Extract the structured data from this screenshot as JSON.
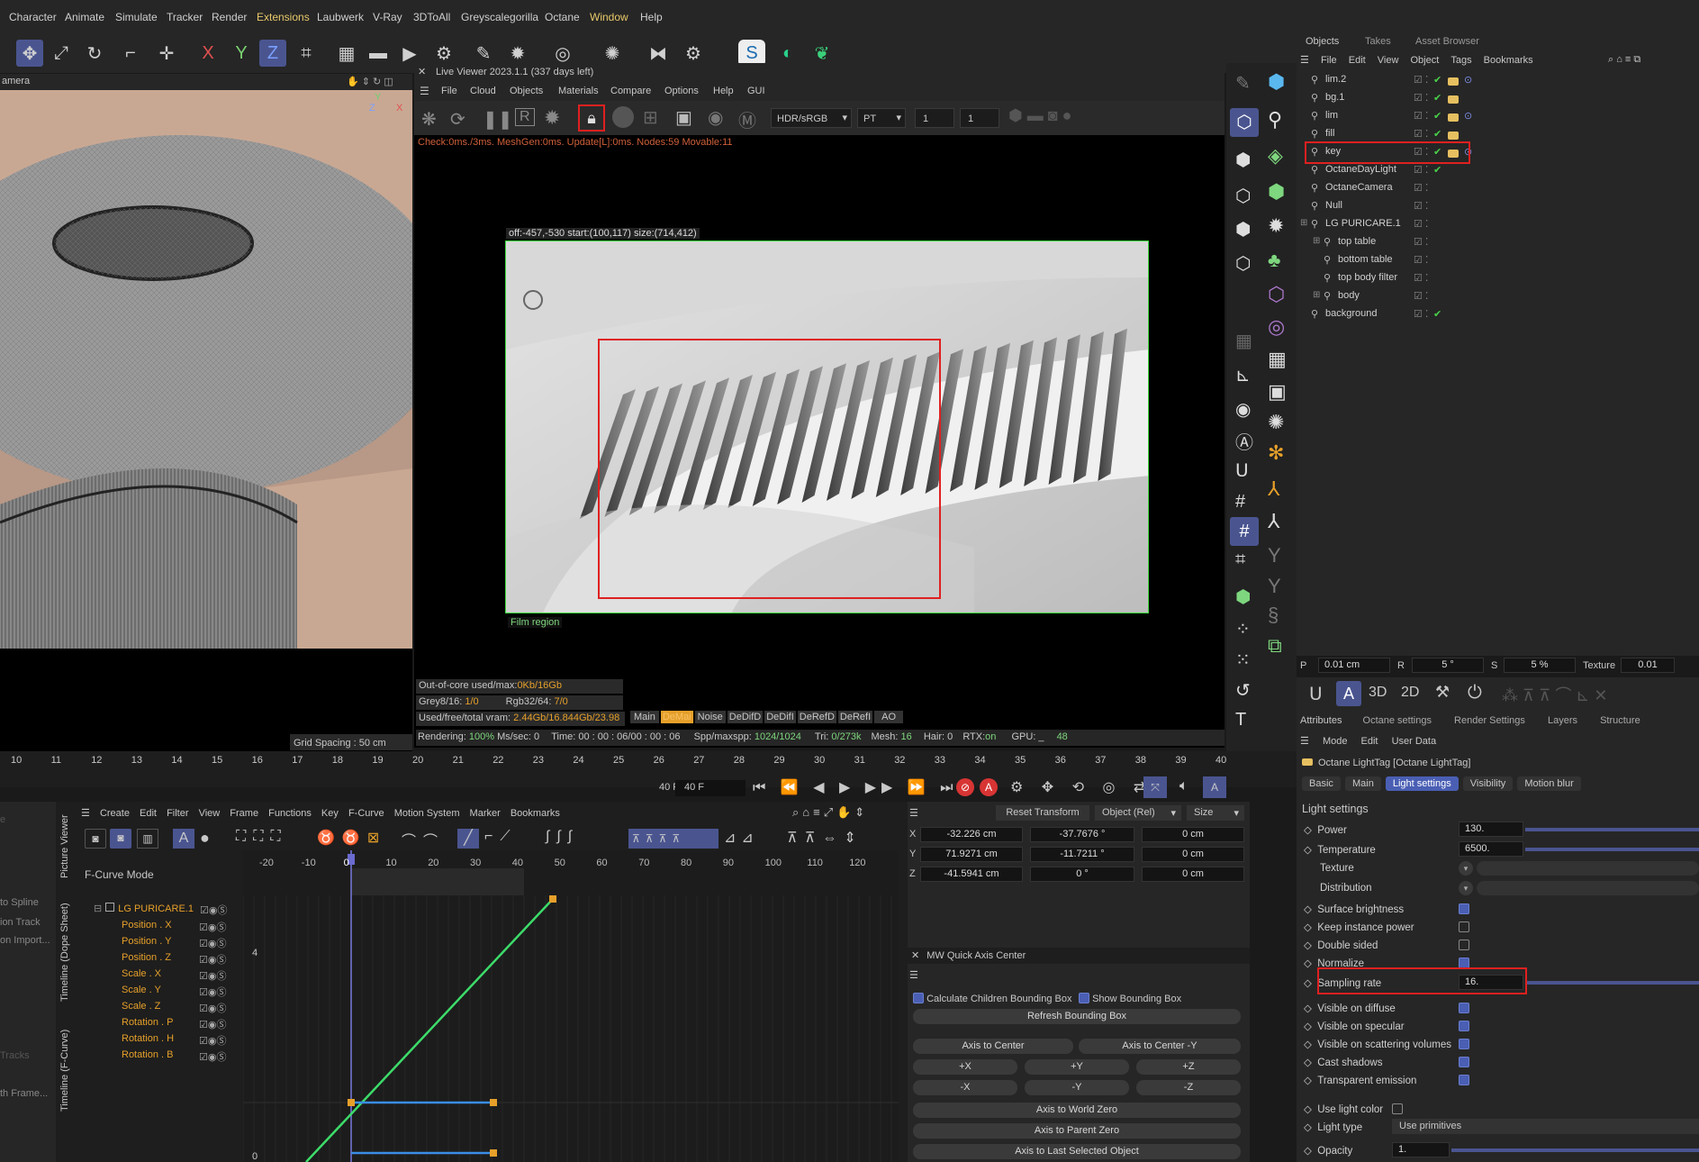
{
  "menubar": {
    "items": [
      "Character",
      "Animate",
      "Simulate",
      "Tracker",
      "Render",
      "Extensions",
      "Laubwerk",
      "V-Ray",
      "3DToAll",
      "Greyscalegorilla",
      "Octane",
      "Window",
      "Help"
    ]
  },
  "viewport": {
    "camera_label": "amera",
    "grid_spacing": "Grid Spacing : 50 cm",
    "axis_y": "Y",
    "axis_z": "Z",
    "axis_x": "X"
  },
  "live_viewer": {
    "title": "Live Viewer 2023.1.1 (337 days left)",
    "menu": [
      "File",
      "Cloud",
      "Objects",
      "Materials",
      "Compare",
      "Options",
      "Help",
      "GUI"
    ],
    "color_space": "HDR/sRGB",
    "kernel": "PT",
    "field1": "1",
    "field2": "1",
    "check_line": "Check:0ms./3ms. MeshGen:0ms. Update[L]:0ms. Nodes:59 Movable:11",
    "region_info": "off:-457,-530 start:(100,117) size:(714,412)",
    "film_region": "Film region",
    "out_of_core": "Out-of-core used/max:",
    "out_of_core_val": "0Kb/16Gb",
    "grey": "Grey8/16: ",
    "grey_val": "1/0",
    "rgb": "Rgb32/64: ",
    "rgb_val": "7/0",
    "vram": "Used/free/total vram: ",
    "vram_val": "2.44Gb/16.844Gb/23.98",
    "tabs": [
      "Main",
      "DeMai",
      "Noise",
      "DeDifD",
      "DeDifI",
      "DeRefD",
      "DeRefI",
      "AO"
    ],
    "rendering": "Rendering: ",
    "rendering_val": "100%",
    "mss": " Ms/sec: 0",
    "time": "Time: 00 : 00 : 06/00 : 00 : 06",
    "spp": "Spp/maxspp: ",
    "spp_val": "1024/1024",
    "tri": "Tri: ",
    "tri_val": "0/273k",
    "mesh": "Mesh: ",
    "mesh_val": "16",
    "hair": "Hair: 0",
    "rtx": "RTX:",
    "rtx_val": "on",
    "gpu": "GPU: _",
    "gpu_val": "48"
  },
  "objects_panel": {
    "tabs": [
      "Objects",
      "Takes",
      "Asset Browser"
    ],
    "menu": [
      "File",
      "Edit",
      "View",
      "Object",
      "Tags",
      "Bookmarks"
    ],
    "rows": [
      {
        "name": "lim.2",
        "indent": 0
      },
      {
        "name": "bg.1",
        "indent": 0
      },
      {
        "name": "lim",
        "indent": 0
      },
      {
        "name": "fill",
        "indent": 0
      },
      {
        "name": "key",
        "indent": 0
      },
      {
        "name": "OctaneDayLight",
        "indent": 0
      },
      {
        "name": "OctaneCamera",
        "indent": 0
      },
      {
        "name": "Null",
        "indent": 0
      },
      {
        "name": "LG PURICARE.1",
        "indent": 0
      },
      {
        "name": "top table",
        "indent": 1
      },
      {
        "name": "bottom table",
        "indent": 1
      },
      {
        "name": "top body filter",
        "indent": 1
      },
      {
        "name": "body",
        "indent": 1
      },
      {
        "name": "background",
        "indent": 0
      }
    ],
    "coord_row": {
      "p_label": "P",
      "p_val": "0.01 cm",
      "r_label": "R",
      "r_val": "5 °",
      "s_label": "S",
      "s_val": "5 %",
      "tex_label": "Texture",
      "tex_val": "0.01"
    }
  },
  "attributes": {
    "tabs": [
      "Attributes",
      "Octane settings",
      "Render Settings",
      "Layers",
      "Structure"
    ],
    "menu": [
      "Mode",
      "Edit",
      "User Data"
    ],
    "tag_title": "Octane LightTag [Octane LightTag]",
    "subtabs": [
      "Basic",
      "Main",
      "Light settings",
      "Visibility",
      "Motion blur"
    ],
    "section": "Light settings",
    "power_label": "Power",
    "power_val": "130.",
    "temp_label": "Temperature",
    "temp_val": "6500.",
    "texture_label": "Texture",
    "distribution_label": "Distribution",
    "surface_brightness": "Surface brightness",
    "keep_instance": "Keep instance power",
    "double_sided": "Double sided",
    "normalize": "Normalize",
    "sampling_label": "Sampling rate",
    "sampling_val": "16.",
    "vis_diffuse": "Visible on diffuse",
    "vis_specular": "Visible on specular",
    "vis_scatter": "Visible on scattering volumes",
    "cast_shadows": "Cast shadows",
    "transparent_emission": "Transparent emission",
    "use_light_color": "Use light color",
    "light_type_label": "Light type",
    "light_type_val": "Use primitives",
    "opacity_label": "Opacity",
    "opacity_val": "1."
  },
  "timeline": {
    "ticks": [
      "10",
      "11",
      "12",
      "13",
      "14",
      "15",
      "16",
      "17",
      "18",
      "19",
      "20",
      "21",
      "22",
      "23",
      "24",
      "25",
      "26",
      "27",
      "28",
      "29",
      "30",
      "31",
      "32",
      "33",
      "34",
      "35",
      "36",
      "37",
      "38",
      "39",
      "40"
    ],
    "frame_a": "40 F",
    "frame_b": "40 F"
  },
  "fcurve": {
    "menu": [
      "Create",
      "Edit",
      "Filter",
      "View",
      "Frame",
      "Functions",
      "Key",
      "F-Curve",
      "Motion System",
      "Marker",
      "Bookmarks"
    ],
    "mode": "F-Curve Mode",
    "object": "LG PURICARE.1",
    "tracks": [
      "Position . X",
      "Position . Y",
      "Position . Z",
      "Scale . X",
      "Scale . Y",
      "Scale . Z",
      "Rotation . P",
      "Rotation . H",
      "Rotation . B"
    ],
    "ruler": [
      "-20",
      "-10",
      "0",
      "10",
      "20",
      "30",
      "40",
      "50",
      "60",
      "70",
      "80",
      "90",
      "100",
      "110",
      "120"
    ],
    "y4": "4",
    "y0": "0",
    "side_labels": [
      "Picture Viewer",
      "Timeline (Dope Sheet)",
      "Timeline (F-Curve)"
    ],
    "left_items": [
      "to Spline",
      "ion Track",
      "on Import...",
      "Tracks",
      "th Frame..."
    ]
  },
  "coords": {
    "reset": "Reset Transform",
    "mode": "Object (Rel)",
    "size": "Size",
    "rows": [
      {
        "axis": "X",
        "pos": "-32.226 cm",
        "rot": "-37.7676 °",
        "size": "0 cm"
      },
      {
        "axis": "Y",
        "pos": "71.9271 cm",
        "rot": "-11.7211 °",
        "size": "0 cm"
      },
      {
        "axis": "Z",
        "pos": "-41.5941 cm",
        "rot": "0 °",
        "size": "0 cm"
      }
    ]
  },
  "quick_axis": {
    "title": "MW Quick Axis Center",
    "calc": "Calculate Children Bounding Box",
    "show": "Show Bounding Box",
    "refresh": "Refresh Bounding Box",
    "axis_center": "Axis to Center",
    "axis_center_y": "Axis to Center -Y",
    "px": "+X",
    "py": "+Y",
    "pz": "+Z",
    "nx": "-X",
    "ny": "-Y",
    "nz": "-Z",
    "world_zero": "Axis to World Zero",
    "parent_zero": "Axis to Parent Zero",
    "last_selected": "Axis to Last Selected Object"
  },
  "colors": {
    "accent": "#4a5fb4",
    "highlight_red": "#e02020",
    "track_orange": "#e6a02a",
    "curve_green": "#3ddc6a",
    "curve_blue": "#3a8ee6"
  }
}
